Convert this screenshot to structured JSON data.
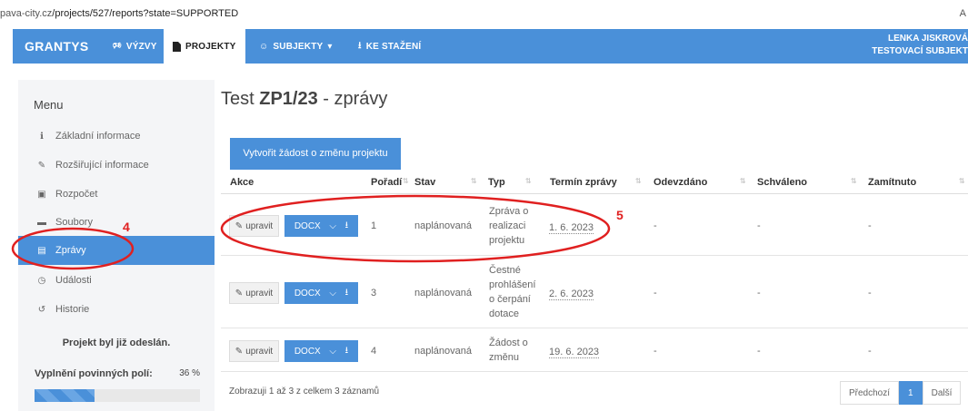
{
  "browser": {
    "url_prefix": "pava-city.cz",
    "url_path": "/projects/527/reports?state=SUPPORTED",
    "edge_char": "A"
  },
  "nav": {
    "brand": "GRANTYS",
    "items": [
      {
        "label": "VÝZVY",
        "icon": "megaphone-icon"
      },
      {
        "label": "PROJEKTY",
        "icon": "file-icon",
        "active": true
      },
      {
        "label": "SUBJEKTY",
        "icon": "group-icon",
        "dropdown": true
      },
      {
        "label": "KE STAŽENÍ",
        "icon": "download-icon"
      }
    ],
    "user_name": "LENKA JISKROVÁ",
    "user_subject": "TESTOVACÍ SUBJEKT"
  },
  "sidebar": {
    "title": "Menu",
    "items": [
      {
        "label": "Základní informace",
        "icon": "info-icon"
      },
      {
        "label": "Rozšiřující informace",
        "icon": "edit-icon"
      },
      {
        "label": "Rozpočet",
        "icon": "money-icon"
      },
      {
        "label": "Soubory",
        "icon": "folder-icon"
      },
      {
        "label": "Zprávy",
        "icon": "list-icon",
        "active": true
      },
      {
        "label": "Události",
        "icon": "clock-icon"
      },
      {
        "label": "Historie",
        "icon": "history-icon"
      }
    ],
    "sent_text": "Projekt byl již odeslán.",
    "fill_label": "Vyplnění povinných polí:",
    "fill_percent_text": "36 %",
    "fill_fraction": 0.36
  },
  "main": {
    "title_prefix": "Test",
    "title_code": "ZP1/23",
    "title_suffix": "- zprávy",
    "create_button": "Vytvořit žádost o změnu projektu",
    "columns": [
      "Akce",
      "Pořadí",
      "Stav",
      "Typ",
      "Termín zprávy",
      "Odevzdáno",
      "Schváleno",
      "Zamítnuto"
    ],
    "edit_label": "upravit",
    "docx_label": "DOCX",
    "rows": [
      {
        "order": "1",
        "state": "naplánovaná",
        "type_lines": [
          "Zpráva o",
          "realizaci",
          "projektu"
        ],
        "date": "1. 6. 2023",
        "submitted": "-",
        "approved": "-",
        "rejected": "-"
      },
      {
        "order": "3",
        "state": "naplánovaná",
        "type_lines": [
          "Čestné",
          "prohlášení",
          "o čerpání",
          "dotace"
        ],
        "date": "2. 6. 2023",
        "submitted": "-",
        "approved": "-",
        "rejected": "-"
      },
      {
        "order": "4",
        "state": "naplánovaná",
        "type_lines": [
          "Žádost o",
          "změnu"
        ],
        "date": "19. 6. 2023",
        "submitted": "-",
        "approved": "-",
        "rejected": "-"
      }
    ],
    "footer_info": "Zobrazuji 1 až 3 z celkem 3 záznamů",
    "pager": {
      "prev": "Předchozí",
      "current": "1",
      "next": "Další"
    }
  },
  "annotations": {
    "label_4": "4",
    "label_5": "5",
    "color": "#e02020"
  }
}
